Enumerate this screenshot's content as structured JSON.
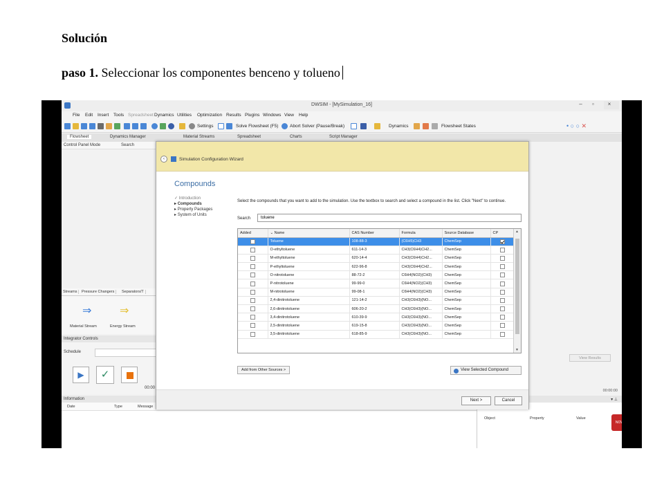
{
  "document": {
    "heading": "Solución",
    "step_label": "paso 1.",
    "step_text": " Seleccionar los componentes benceno y tolueno"
  },
  "app": {
    "window_title": "DWSIM - [MySimulation_16]",
    "menu": [
      "File",
      "Edit",
      "Insert",
      "Tools",
      "Spreadsheet",
      "Dynamics",
      "Utilities",
      "Optimization",
      "Results",
      "Plugins",
      "Windows",
      "View",
      "Help"
    ],
    "toolbar": {
      "settings": "Settings",
      "solve": "Solve Flowsheet (F5)",
      "abort": "Abort Solver (Pause/Break)",
      "dynamics": "Dynamics",
      "flowsheet_states": "Flowsheet States"
    },
    "tabs": [
      "Flowsheet",
      "Dynamics Manager",
      "Material Streams",
      "Spreadsheet",
      "Charts",
      "Script Manager"
    ],
    "control_panel": {
      "mode": "Control Panel Mode",
      "search": "Search"
    },
    "palette": {
      "tabs": [
        "Streams",
        "Pressure Changers",
        "Separators/T"
      ],
      "material_stream": "Material Stream",
      "energy_stream": "Energy Stream"
    },
    "integrator": {
      "title": "Integrator Controls",
      "schedule": "Schedule",
      "time_left": "00:00",
      "time_right": "00:00:00",
      "view_results": "View Results"
    },
    "information": {
      "title": "Information",
      "columns": [
        "Date",
        "Type",
        "Message"
      ],
      "right_columns": [
        "Object",
        "Property",
        "Value"
      ]
    },
    "logo_text": "NOW"
  },
  "wizard": {
    "title": "Simulation Configuration Wizard",
    "heading": "Compounds",
    "steps": {
      "introduction": "Introduction",
      "compounds": "Compounds",
      "property_packages": "Property Packages",
      "system_of_units": "System of Units"
    },
    "instructions": "Select the compounds that you want to add to the simulation. Use the textbox to search and select a compound in the list. Click \"Next\" to continue.",
    "search_label": "Search",
    "search_value": "toluene",
    "columns": [
      "Added",
      "Name",
      "CAS Number",
      "Formula",
      "Source Database",
      "CP"
    ],
    "rows": [
      {
        "added": false,
        "name": "Toluene",
        "cas": "108-88-3",
        "formula": "(C6H5)CH3",
        "source": "ChemSep",
        "cp": true,
        "selected": true
      },
      {
        "added": false,
        "name": "O-ethyltoluene",
        "cas": "611-14-3",
        "formula": "CH3(C6H4)CH2...",
        "source": "ChemSep",
        "cp": false
      },
      {
        "added": false,
        "name": "M-ethyltoluene",
        "cas": "620-14-4",
        "formula": "CH3(C6H4)CH2...",
        "source": "ChemSep",
        "cp": false
      },
      {
        "added": false,
        "name": "P-ethyltoluene",
        "cas": "622-96-8",
        "formula": "CH3(C6H4)CH2...",
        "source": "ChemSep",
        "cp": false
      },
      {
        "added": false,
        "name": "O-nitrotoluene",
        "cas": "88-72-2",
        "formula": "C6H4(NO2)(CH3)",
        "source": "ChemSep",
        "cp": false
      },
      {
        "added": false,
        "name": "P-nitrotoluene",
        "cas": "99-99-0",
        "formula": "C6H4(NO2)(CH3)",
        "source": "ChemSep",
        "cp": false
      },
      {
        "added": false,
        "name": "M-nitrotoluene",
        "cas": "99-08-1",
        "formula": "C6H4(NO2)(CH3)",
        "source": "ChemSep",
        "cp": false
      },
      {
        "added": false,
        "name": "2,4-dinitrotoluene",
        "cas": "121-14-2",
        "formula": "CH3(C6H3)(NO...",
        "source": "ChemSep",
        "cp": false
      },
      {
        "added": false,
        "name": "2,6-dinitrotoluene",
        "cas": "606-20-2",
        "formula": "CH3(C6H3)(NO...",
        "source": "ChemSep",
        "cp": false
      },
      {
        "added": false,
        "name": "3,4-dinitrotoluene",
        "cas": "610-39-9",
        "formula": "CH3(C6H3)(NO...",
        "source": "ChemSep",
        "cp": false
      },
      {
        "added": false,
        "name": "2,5-dinitrotoluene",
        "cas": "619-15-8",
        "formula": "CH3(C6H3)(NO...",
        "source": "ChemSep",
        "cp": false
      },
      {
        "added": false,
        "name": "3,5-dinitrotoluene",
        "cas": "618-85-9",
        "formula": "CH3(C6H3)(NO...",
        "source": "ChemSep",
        "cp": false
      }
    ],
    "add_other_sources": "Add from Other Sources >",
    "view_selected": "View Selected Compound",
    "next": "Next >",
    "cancel": "Cancel"
  }
}
